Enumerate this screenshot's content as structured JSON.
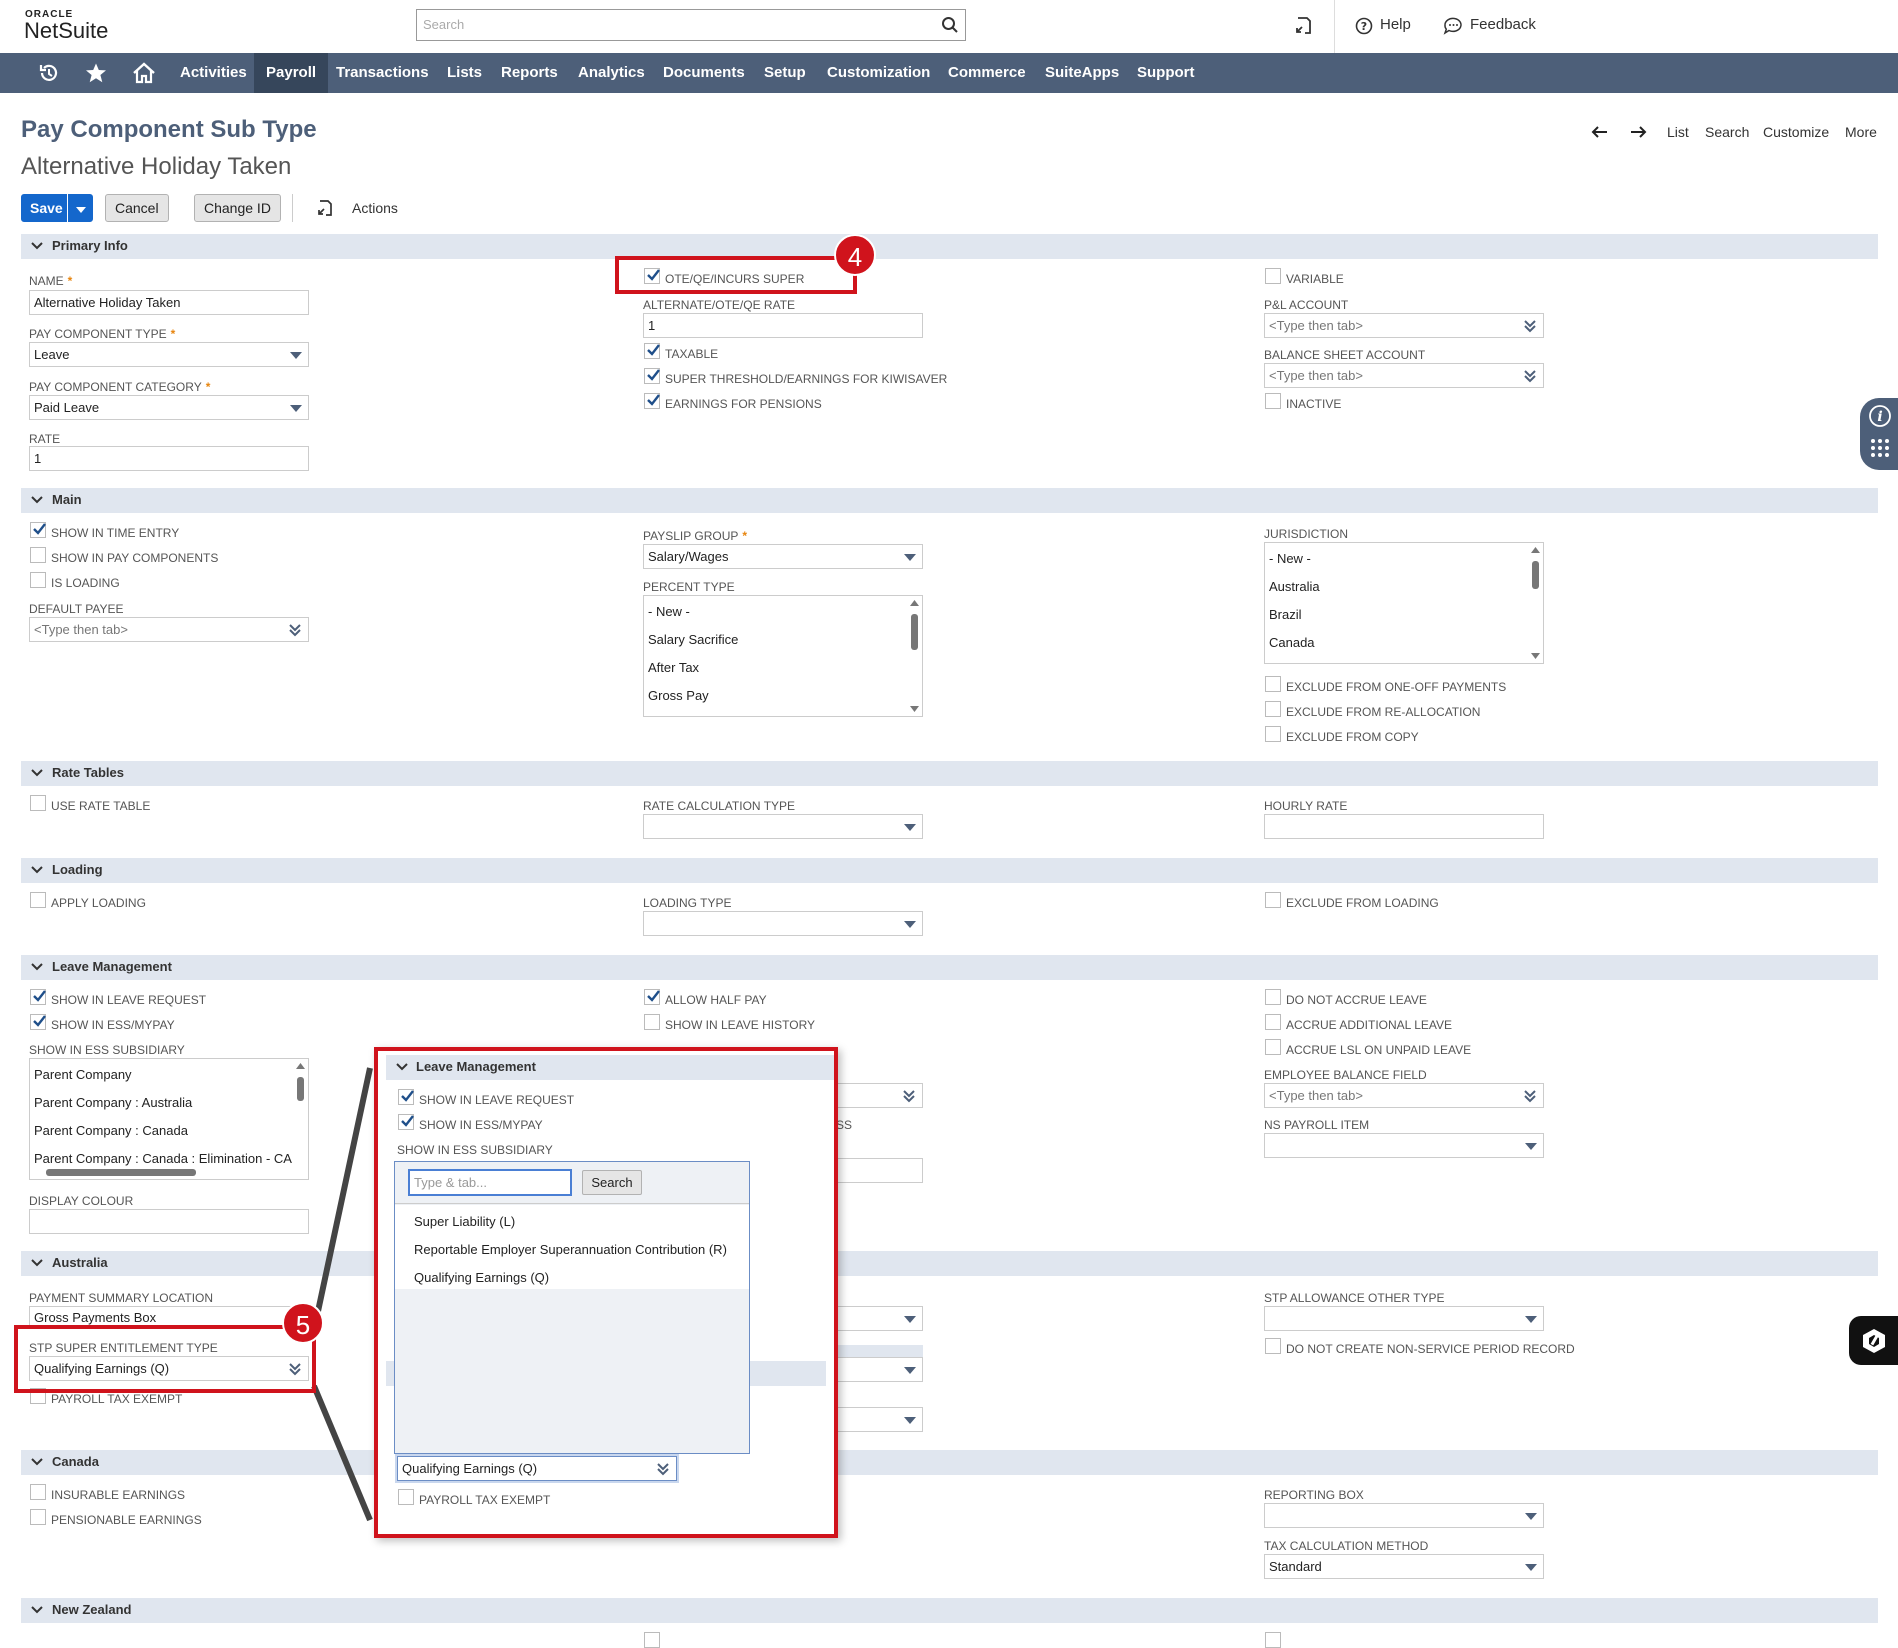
{
  "header": {
    "logo_top": "ORACLE",
    "logo_main": "NetSuite",
    "search_placeholder": "Search",
    "help": "Help",
    "feedback": "Feedback"
  },
  "nav": {
    "items": [
      "Activities",
      "Payroll",
      "Transactions",
      "Lists",
      "Reports",
      "Analytics",
      "Documents",
      "Setup",
      "Customization",
      "Commerce",
      "SuiteApps",
      "Support"
    ],
    "active": "Payroll"
  },
  "page": {
    "title": "Pay Component Sub Type",
    "subtitle": "Alternative Holiday Taken",
    "right_nav": [
      "List",
      "Search",
      "Customize",
      "More"
    ],
    "buttons": {
      "save": "Save",
      "cancel": "Cancel",
      "change_id": "Change ID",
      "actions": "Actions"
    }
  },
  "primary_info": {
    "section": "Primary Info",
    "name_label": "NAME",
    "name_value": "Alternative Holiday Taken",
    "pct_label": "PAY COMPONENT TYPE",
    "pct_value": "Leave",
    "pcc_label": "PAY COMPONENT CATEGORY",
    "pcc_value": "Paid Leave",
    "rate_label": "RATE",
    "rate_value": "1",
    "ote": "OTE/QE/INCURS SUPER",
    "alt_rate_label": "ALTERNATE/OTE/QE RATE",
    "alt_rate_value": "1",
    "taxable": "TAXABLE",
    "super_threshold": "SUPER THRESHOLD/EARNINGS FOR KIWISAVER",
    "earnings_pensions": "EARNINGS FOR PENSIONS",
    "variable": "VARIABLE",
    "pl_label": "P&L ACCOUNT",
    "pl_placeholder": "<Type then tab>",
    "bs_label": "BALANCE SHEET ACCOUNT",
    "bs_placeholder": "<Type then tab>",
    "inactive": "INACTIVE"
  },
  "main": {
    "section": "Main",
    "show_time_entry": "SHOW IN TIME ENTRY",
    "show_pay_components": "SHOW IN PAY COMPONENTS",
    "is_loading": "IS LOADING",
    "default_payee_label": "DEFAULT PAYEE",
    "default_payee_placeholder": "<Type then tab>",
    "payslip_label": "PAYSLIP GROUP",
    "payslip_value": "Salary/Wages",
    "percent_label": "PERCENT TYPE",
    "percent_options": [
      "- New -",
      "Salary Sacrifice",
      "After Tax",
      "Gross Pay"
    ],
    "jurisdiction_label": "JURISDICTION",
    "jurisdiction_options": [
      "- New -",
      "Australia",
      "Brazil",
      "Canada"
    ],
    "excl_oneoff": "EXCLUDE FROM ONE-OFF PAYMENTS",
    "excl_realloc": "EXCLUDE FROM RE-ALLOCATION",
    "excl_copy": "EXCLUDE FROM COPY"
  },
  "rate_tables": {
    "section": "Rate Tables",
    "use_rate_table": "USE RATE TABLE",
    "calc_label": "RATE CALCULATION TYPE",
    "hourly_label": "HOURLY RATE"
  },
  "loading": {
    "section": "Loading",
    "apply_loading": "APPLY LOADING",
    "loading_type_label": "LOADING TYPE",
    "exclude_loading": "EXCLUDE FROM LOADING"
  },
  "leave": {
    "section": "Leave Management",
    "show_leave_request": "SHOW IN LEAVE REQUEST",
    "show_ess": "SHOW IN ESS/MYPAY",
    "ess_sub_label": "SHOW IN ESS SUBSIDIARY",
    "ess_sub_options": [
      "Parent Company",
      "Parent Company : Australia",
      "Parent Company : Canada",
      "Parent Company : Canada : Elimination - CA"
    ],
    "display_colour_label": "DISPLAY COLOUR",
    "allow_half_pay": "ALLOW HALF PAY",
    "show_leave_history": "SHOW IN LEAVE HISTORY",
    "do_not_accrue": "DO NOT ACCRUE LEAVE",
    "accrue_additional": "ACCRUE ADDITIONAL LEAVE",
    "accrue_lsl": "ACCRUE LSL ON UNPAID LEAVE",
    "emp_balance_label": "EMPLOYEE BALANCE FIELD",
    "emp_balance_placeholder": "<Type then tab>",
    "ns_payroll_label": "NS PAYROLL ITEM",
    "partial_text": "SS"
  },
  "australia": {
    "section": "Australia",
    "psl_label": "PAYMENT SUMMARY LOCATION",
    "psl_value": "Gross Payments Box",
    "stp_super_label": "STP SUPER ENTITLEMENT TYPE",
    "stp_super_value": "Qualifying Earnings (Q)",
    "payroll_tax_exempt": "PAYROLL TAX EXEMPT",
    "stp_allowance_label": "STP ALLOWANCE OTHER TYPE",
    "non_service": "DO NOT CREATE NON-SERVICE PERIOD RECORD"
  },
  "canada": {
    "section": "Canada",
    "insurable": "INSURABLE EARNINGS",
    "pensionable": "PENSIONABLE EARNINGS",
    "reporting_label": "REPORTING BOX",
    "tax_calc_label": "TAX CALCULATION METHOD",
    "tax_calc_value": "Standard"
  },
  "nz": {
    "section": "New Zealand"
  },
  "callouts": {
    "four": "4",
    "five": "5"
  },
  "zoom": {
    "section": "Leave Management",
    "show_leave_request": "SHOW IN LEAVE REQUEST",
    "show_ess": "SHOW IN ESS/MYPAY",
    "ess_sub_label": "SHOW IN ESS SUBSIDIARY",
    "popup_placeholder": "Type & tab...",
    "popup_search": "Search",
    "popup_options": [
      "Super Liability (L)",
      "Reportable Employer Superannuation Contribution (R)",
      "Qualifying Earnings (Q)"
    ],
    "field_value": "Qualifying Earnings (Q)",
    "payroll_tax_exempt": "PAYROLL TAX EXEMPT"
  },
  "colors": {
    "nav": "#4d5f79",
    "accent": "#1467cc",
    "callout": "#d0131c",
    "section": "#e0e6ef"
  }
}
